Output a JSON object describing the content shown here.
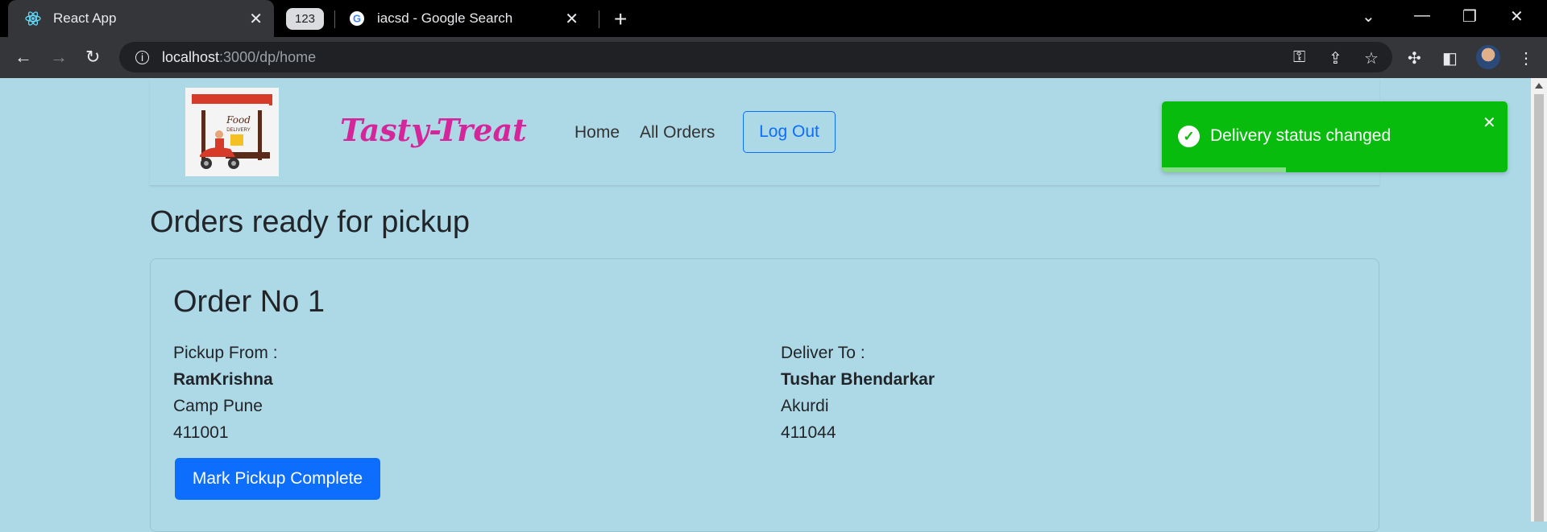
{
  "browser": {
    "tabs": [
      {
        "title": "React App",
        "icon": "react-icon"
      },
      {
        "title": "iacsd - Google Search",
        "icon": "google-icon"
      }
    ],
    "tab_group": "123",
    "url_host": "localhost",
    "url_path": ":3000/dp/home"
  },
  "nav": {
    "brand": "Tasty-Treat",
    "links": [
      "Home",
      "All Orders"
    ],
    "logout_label": "Log Out"
  },
  "main": {
    "heading": "Orders ready for pickup",
    "order": {
      "title": "Order No 1",
      "pickup_label": "Pickup From :",
      "pickup_name": "RamKrishna",
      "pickup_address": "Camp Pune",
      "pickup_pin": "411001",
      "deliver_label": "Deliver To :",
      "deliver_name": "Tushar Bhendarkar",
      "deliver_address": "Akurdi",
      "deliver_pin": "411044",
      "action_label": "Mark Pickup Complete"
    }
  },
  "toast": {
    "message": "Delivery status changed",
    "progress": 0.36,
    "color": "#07bc0c"
  },
  "colors": {
    "page_bg": "#add8e6",
    "brand": "#d4259b",
    "primary": "#0d6efd"
  }
}
